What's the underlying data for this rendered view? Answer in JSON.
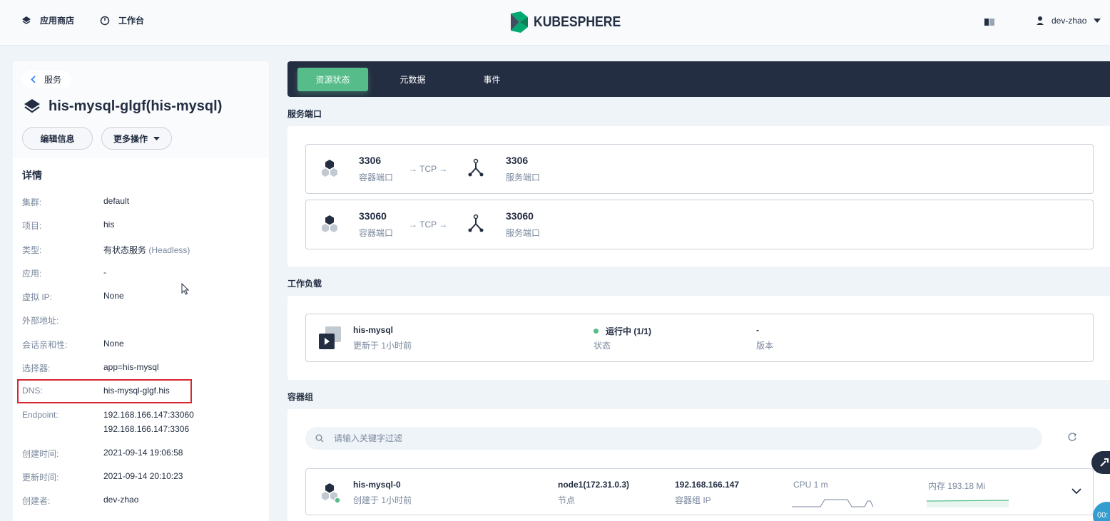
{
  "topbar": {
    "app_store_label": "应用商店",
    "workbench_label": "工作台",
    "logo_text": "KUBESPHERE",
    "username": "dev-zhao"
  },
  "service": {
    "back_label": "服务",
    "title": "his-mysql-glgf(his-mysql)",
    "edit_label": "编辑信息",
    "more_label": "更多操作"
  },
  "details": {
    "heading": "详情",
    "rows": [
      {
        "label": "集群:",
        "value": "default"
      },
      {
        "label": "项目:",
        "value": "his"
      },
      {
        "label": "类型:",
        "value": "有状态服务",
        "extra": "(Headless)"
      },
      {
        "label": "应用:",
        "value": "-"
      },
      {
        "label": "虚拟 IP:",
        "value": "None"
      },
      {
        "label": "外部地址:",
        "value": ""
      },
      {
        "label": "会话亲和性:",
        "value": "None"
      },
      {
        "label": "选择器:",
        "value": "app=his-mysql"
      },
      {
        "label": "DNS:",
        "value": "his-mysql-glgf.his"
      },
      {
        "label": "Endpoint:",
        "value": "192.168.166.147:33060",
        "value2": "192.168.166.147:3306"
      },
      {
        "label": "创建时间:",
        "value": "2021-09-14 19:06:58"
      },
      {
        "label": "更新时间:",
        "value": "2021-09-14 20:10:23"
      },
      {
        "label": "创建者:",
        "value": "dev-zhao"
      }
    ]
  },
  "tabs": [
    "资源状态",
    "元数据",
    "事件"
  ],
  "ports_section": {
    "title": "服务端口",
    "items": [
      {
        "container_port": "3306",
        "container_label": "容器端口",
        "protocol": "→ TCP →",
        "service_port": "3306",
        "service_label": "服务端口"
      },
      {
        "container_port": "33060",
        "container_label": "容器端口",
        "protocol": "→ TCP →",
        "service_port": "33060",
        "service_label": "服务端口"
      }
    ]
  },
  "workload_section": {
    "title": "工作负载",
    "name": "his-mysql",
    "updated": "更新于 1小时前",
    "status": "运行中 (1/1)",
    "status_label": "状态",
    "version": "-",
    "version_label": "版本"
  },
  "pods_section": {
    "title": "容器组",
    "search_placeholder": "请输入关键字过滤",
    "pod": {
      "name": "his-mysql-0",
      "created": "创建于 1小时前",
      "node": "node1(172.31.0.3)",
      "node_label": "节点",
      "ip": "192.168.166.147",
      "ip_label": "容器组 IP",
      "cpu": "CPU 1 m",
      "memory": "内存 193.18 Mi"
    }
  },
  "float_label": "00:"
}
